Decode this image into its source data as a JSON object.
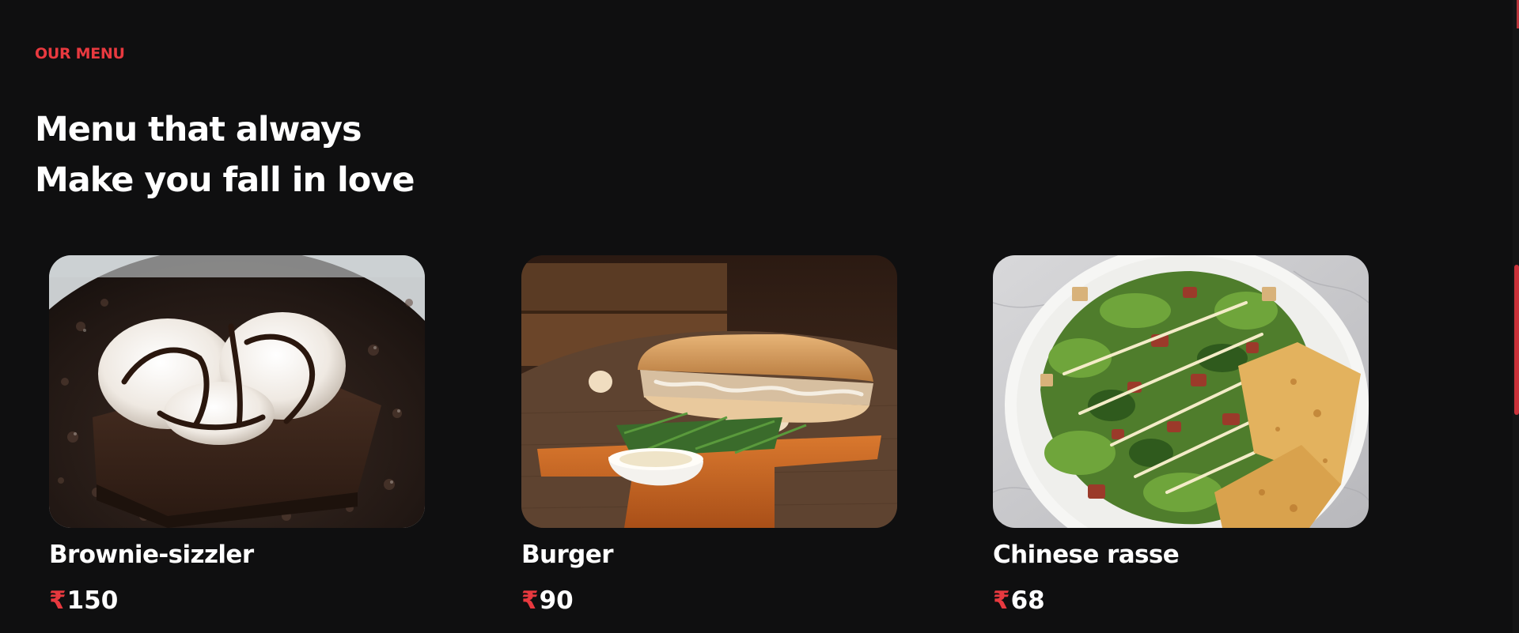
{
  "section": {
    "eyebrow": "OUR MENU",
    "headline_line1": "Menu that always",
    "headline_line2": "Make you fall in love"
  },
  "colors": {
    "accent": "#e8393f",
    "background": "#0f0f10",
    "text": "#ffffff"
  },
  "menu_items": [
    {
      "name": "Brownie-sizzler",
      "currency": "₹",
      "price": "150",
      "image": "brownie-sizzler-photo"
    },
    {
      "name": "Burger",
      "currency": "₹",
      "price": "90",
      "image": "burger-photo"
    },
    {
      "name": "Chinese rasse",
      "currency": "₹",
      "price": "68",
      "image": "salad-photo"
    }
  ]
}
